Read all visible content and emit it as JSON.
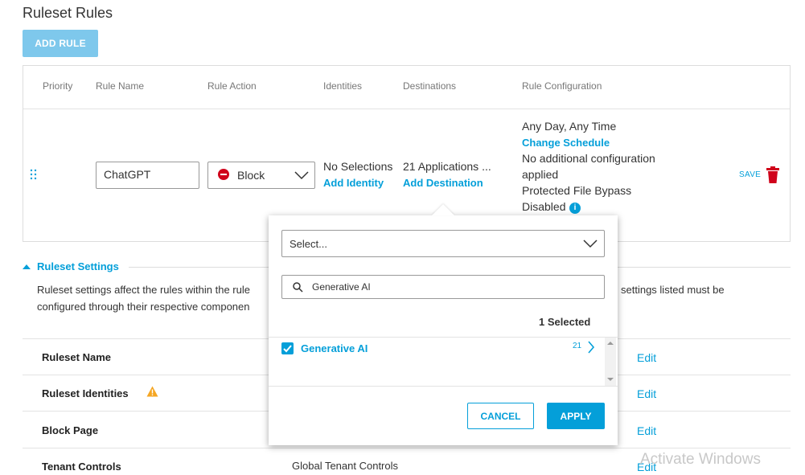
{
  "page": {
    "title": "Ruleset Rules",
    "add_rule_label": "ADD RULE"
  },
  "table": {
    "headers": [
      "Priority",
      "Rule Name",
      "Rule Action",
      "Identities",
      "Destinations",
      "Rule Configuration"
    ],
    "row": {
      "rule_name": "ChatGPT",
      "rule_action": "Block",
      "identities": "No Selections",
      "add_identity": "Add Identity",
      "destinations": "21 Applications ...",
      "add_destination": "Add Destination",
      "config_schedule": "Any Day, Any Time",
      "change_schedule": "Change Schedule",
      "config_line_1": "No additional configuration",
      "config_line_2": "applied",
      "config_line_3": "Protected File Bypass",
      "config_line_4": "Disabled",
      "save_label": "SAVE"
    }
  },
  "settings": {
    "toggle_label": "Ruleset Settings",
    "description_left_1": "Ruleset settings affect the rules within the rule",
    "description_left_2": "configured through their respective componen",
    "description_right_1": "settings listed must be",
    "rows": [
      {
        "label": "Ruleset Name",
        "value": "",
        "edit": "Edit"
      },
      {
        "label": "Ruleset Identities",
        "value": "",
        "edit": "Edit"
      },
      {
        "label": "Block Page",
        "value": "",
        "edit": "Edit"
      },
      {
        "label": "Tenant Controls",
        "value": "Global Tenant Controls",
        "edit": "Edit"
      }
    ]
  },
  "popup": {
    "select_placeholder": "Select...",
    "search_value": "Generative AI",
    "selected_count": "1 Selected",
    "items": [
      {
        "label": "Generative AI",
        "count": "21",
        "checked": true
      }
    ],
    "cancel_label": "CANCEL",
    "apply_label": "APPLY"
  },
  "watermark": "Activate Windows",
  "colors": {
    "accent": "#049fd9",
    "block_red": "#d0021b",
    "warning": "#f5a623",
    "add_rule_bg": "#7ec8ec"
  }
}
